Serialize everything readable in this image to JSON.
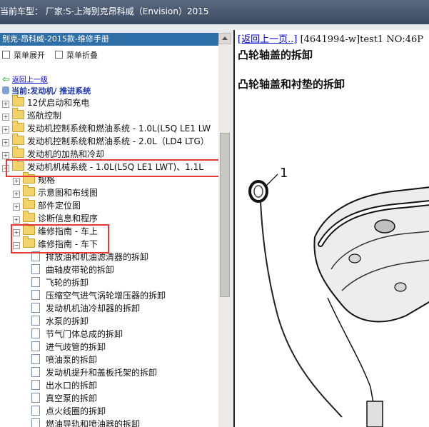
{
  "window": {
    "title": "当前车型： 厂家:S-上海别克昂科威（Envision）2015"
  },
  "left": {
    "header": "别克-昂科威-2015款-维修手册",
    "tools": {
      "expand": "菜单展开",
      "collapse": "菜单折叠"
    },
    "back": "返回上一级",
    "current": "当前:发动机/ 推进系统",
    "tree": [
      {
        "label": "12伏启动和充电",
        "level": 0,
        "type": "folder",
        "toggle": "+"
      },
      {
        "label": "巡航控制",
        "level": 0,
        "type": "folder",
        "toggle": "+"
      },
      {
        "label": "发动机控制系统和燃油系统 - 1.0L(L5Q LE1 LW",
        "level": 0,
        "type": "folder",
        "toggle": "+"
      },
      {
        "label": "发动机控制系统和燃油系统 - 2.0L（LD4 LTG）",
        "level": 0,
        "type": "folder",
        "toggle": "+"
      },
      {
        "label": "发动机的加热和冷却",
        "level": 0,
        "type": "folder",
        "toggle": "+"
      },
      {
        "label": "发动机机械系统 - 1.0L(L5Q LE1 LWT)、1.1L",
        "level": 0,
        "type": "folder",
        "toggle": "-"
      },
      {
        "label": "规格",
        "level": 1,
        "type": "folder",
        "toggle": "+"
      },
      {
        "label": "示意图和布线图",
        "level": 1,
        "type": "folder",
        "toggle": "+"
      },
      {
        "label": "部件定位图",
        "level": 1,
        "type": "folder",
        "toggle": "+"
      },
      {
        "label": "诊断信息和程序",
        "level": 1,
        "type": "folder",
        "toggle": "+"
      },
      {
        "label": "维修指南 - 车上",
        "level": 1,
        "type": "folder",
        "toggle": "+"
      },
      {
        "label": "维修指南 - 车下",
        "level": 1,
        "type": "folder",
        "toggle": "-"
      },
      {
        "label": "排放油和机油滤清器的拆卸",
        "level": 2,
        "type": "doc"
      },
      {
        "label": "曲轴皮带轮的拆卸",
        "level": 2,
        "type": "doc"
      },
      {
        "label": "飞轮的拆卸",
        "level": 2,
        "type": "doc"
      },
      {
        "label": "压缩空气进气涡轮增压器的拆卸",
        "level": 2,
        "type": "doc"
      },
      {
        "label": "发动机机油冷却器的拆卸",
        "level": 2,
        "type": "doc"
      },
      {
        "label": "水泵的拆卸",
        "level": 2,
        "type": "doc"
      },
      {
        "label": "节气门体总成的拆卸",
        "level": 2,
        "type": "doc"
      },
      {
        "label": "进气歧管的拆卸",
        "level": 2,
        "type": "doc"
      },
      {
        "label": "喷油泵的拆卸",
        "level": 2,
        "type": "doc"
      },
      {
        "label": "发动机提升和盖板托架的拆卸",
        "level": 2,
        "type": "doc"
      },
      {
        "label": "出水口的拆卸",
        "level": 2,
        "type": "doc"
      },
      {
        "label": "真空泵的拆卸",
        "level": 2,
        "type": "doc"
      },
      {
        "label": "点火线圈的拆卸",
        "level": 2,
        "type": "doc"
      },
      {
        "label": "燃油导轨和喷油器的拆卸",
        "level": 2,
        "type": "doc"
      }
    ]
  },
  "right": {
    "back_link": "[返回上一页..]",
    "doc_info": "[4641994-w]test1 NO:46P",
    "title": "凸轮轴盖的拆卸",
    "subtitle": "凸轮轴盖和衬垫的拆卸",
    "callout": "1"
  },
  "colors": {
    "highlight": "#e53935",
    "header_bg": "#2f6fa7",
    "link": "#0000cc"
  }
}
